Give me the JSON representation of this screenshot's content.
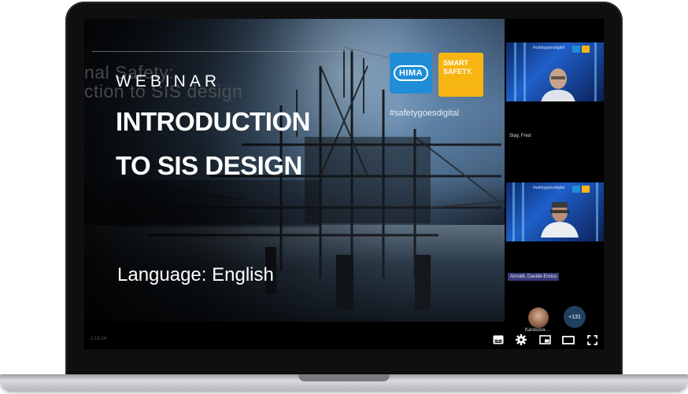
{
  "slide": {
    "ghost_line1": "nal Safety:",
    "ghost_line2": "ction to SIS design",
    "webinar": "WEBINAR",
    "title_line1": "INTRODUCTION",
    "title_line2": "TO SIS DESIGN",
    "language": "Language: English",
    "logo_hima": "HIMA",
    "logo_smart_line1": "SMART",
    "logo_smart_line2": "SAFETY.",
    "hashtag": "#safetygoesdigital",
    "time_hint": "1:16:14"
  },
  "participants": {
    "tile1_tag": "#safetygoesdigital",
    "tile1_name": "Stay, Fred",
    "tile2_tag": "#safetygoesdigital",
    "tile2_name": "Arnoldi, Davide Enrico",
    "avatar_name": "Karasova…",
    "more_count": "+131"
  },
  "controls": {
    "subtitles": "subtitles-icon",
    "settings": "gear-icon",
    "miniplayer": "miniplayer-icon",
    "theater": "theater-mode-icon",
    "fullscreen": "fullscreen-icon"
  },
  "colors": {
    "hima_blue": "#1f8ed6",
    "smart_yellow": "#f7b512",
    "name_badge": "#3a3a78"
  }
}
